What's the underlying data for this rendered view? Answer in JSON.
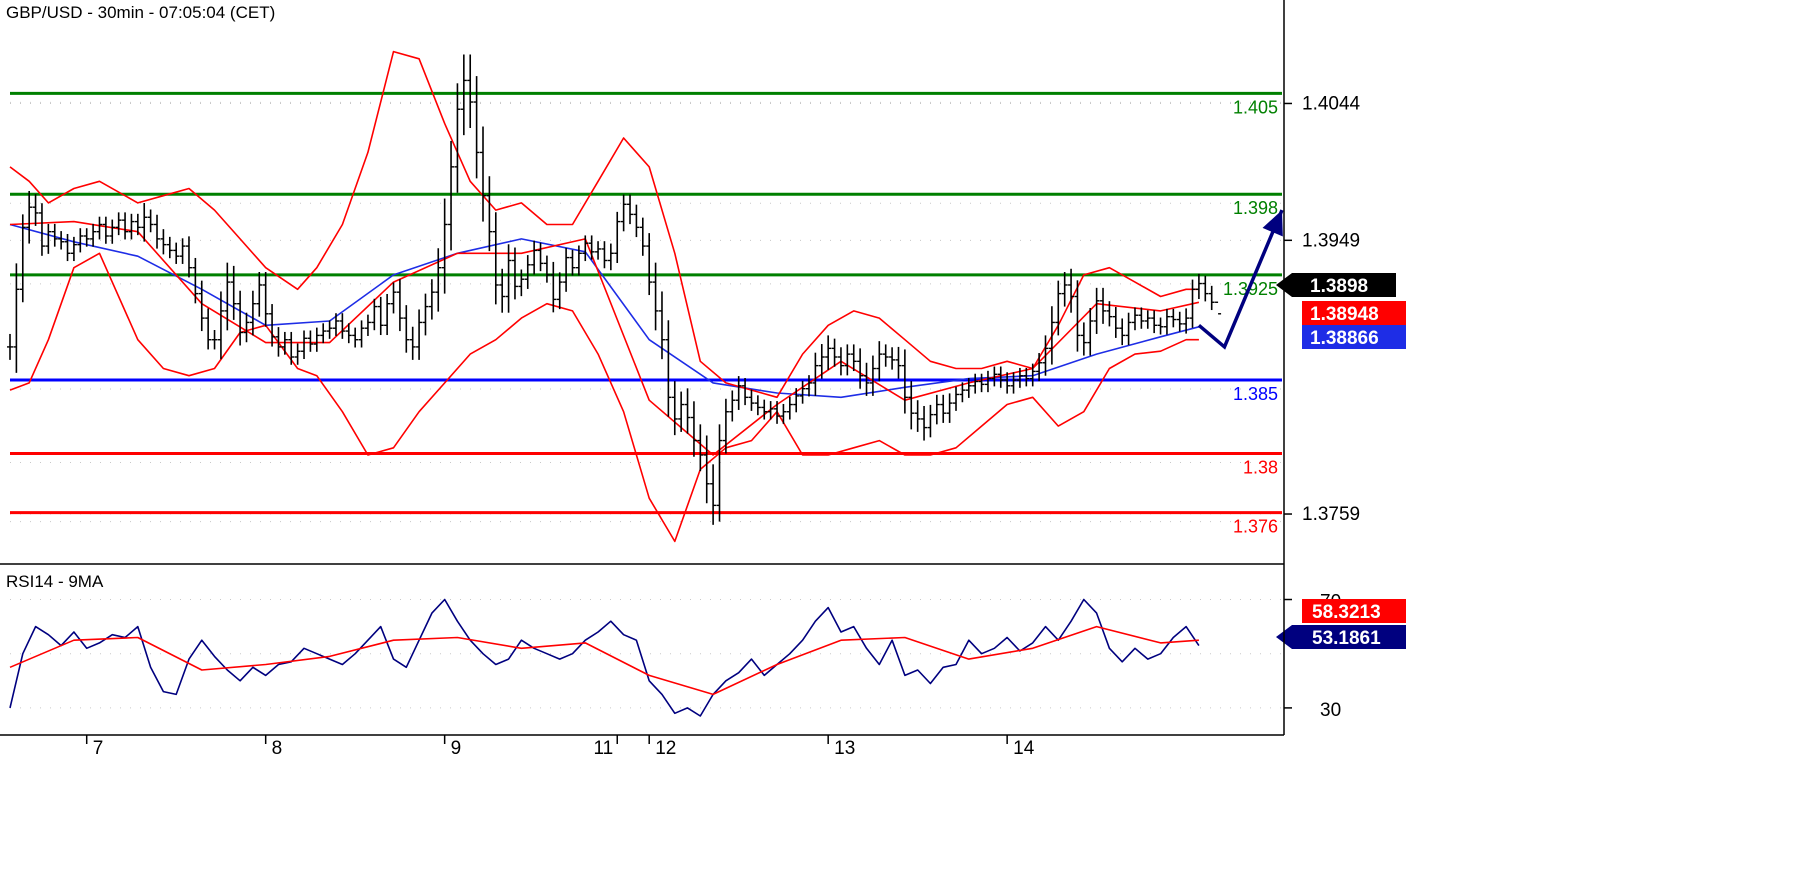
{
  "chart_data": [
    {
      "type": "line",
      "title": "GBP/USD - 30min - 07:05:04 (CET)",
      "ylim": [
        1.3725,
        1.4095
      ],
      "y_ticks": [
        "1.4044",
        "1.3949",
        "1.3759"
      ],
      "x_ticks": [
        "7",
        "8",
        "9",
        "11",
        "12",
        "13",
        "14"
      ],
      "grid": true,
      "levels": [
        {
          "label": "1.405",
          "value": 1.4051,
          "color": "#008000"
        },
        {
          "label": "1.398",
          "value": 1.3981,
          "color": "#008000"
        },
        {
          "label": "1.3925",
          "value": 1.3925,
          "color": "#008000"
        },
        {
          "label": "1.385",
          "value": 1.3852,
          "color": "#0000ff"
        },
        {
          "label": "1.38",
          "value": 1.3801,
          "color": "#ff0000"
        },
        {
          "label": "1.376",
          "value": 1.376,
          "color": "#ff0000"
        }
      ],
      "price_tags": [
        {
          "label": "1.3898",
          "value": 1.3898,
          "color": "#000000"
        },
        {
          "label": "1.38948",
          "value": 1.38948,
          "color": "#ff0000"
        },
        {
          "label": "1.38866",
          "value": 1.38866,
          "color": "#1e2de6"
        }
      ],
      "series": [
        {
          "type": "ohlc",
          "color": "#000000",
          "close": [
            1.3875,
            1.3915,
            1.3958,
            1.3972,
            1.3968,
            1.3945,
            1.3955,
            1.395,
            1.3948,
            1.394,
            1.3946,
            1.3952,
            1.395,
            1.3955,
            1.396,
            1.3952,
            1.3958,
            1.3963,
            1.3955,
            1.3962,
            1.3958,
            1.3965,
            1.396,
            1.395,
            1.3946,
            1.3942,
            1.3938,
            1.3945,
            1.393,
            1.3912,
            1.3895,
            1.388,
            1.388,
            1.39,
            1.392,
            1.3905,
            1.3885,
            1.3892,
            1.3905,
            1.3918,
            1.3898,
            1.3882,
            1.3875,
            1.388,
            1.3868,
            1.3872,
            1.3881,
            1.3877,
            1.3883,
            1.3886,
            1.3888,
            1.3893,
            1.3886,
            1.3883,
            1.388,
            1.3888,
            1.3892,
            1.3903,
            1.389,
            1.3905,
            1.3913,
            1.3895,
            1.388,
            1.3875,
            1.3892,
            1.3903,
            1.3913,
            1.393,
            1.396,
            1.4,
            1.404,
            1.406,
            1.4045,
            1.401,
            1.398,
            1.3955,
            1.3918,
            1.391,
            1.3935,
            1.3917,
            1.3922,
            1.3932,
            1.3942,
            1.3933,
            1.3925,
            1.3908,
            1.392,
            1.3937,
            1.393,
            1.394,
            1.3947,
            1.3941,
            1.3943,
            1.3935,
            1.394,
            1.3962,
            1.3974,
            1.3967,
            1.3958,
            1.3945,
            1.392,
            1.39,
            1.388,
            1.384,
            1.3825,
            1.3835,
            1.3826,
            1.381,
            1.38,
            1.378,
            1.3765,
            1.381,
            1.383,
            1.3838,
            1.3848,
            1.384,
            1.3836,
            1.3833,
            1.383,
            1.3832,
            1.3827,
            1.383,
            1.3835,
            1.3841,
            1.3846,
            1.385,
            1.3862,
            1.3868,
            1.3874,
            1.3868,
            1.3862,
            1.387,
            1.3865,
            1.3855,
            1.385,
            1.386,
            1.387,
            1.3868,
            1.3866,
            1.3862,
            1.384,
            1.3829,
            1.3825,
            1.3819,
            1.3828,
            1.3835,
            1.3829,
            1.3836,
            1.3842,
            1.3845,
            1.3848,
            1.3851,
            1.3849,
            1.3853,
            1.3856,
            1.3852,
            1.3848,
            1.3852,
            1.3855,
            1.3853,
            1.3858,
            1.3864,
            1.3874,
            1.3892,
            1.3912,
            1.3918,
            1.391,
            1.3883,
            1.3878,
            1.3893,
            1.3907,
            1.39,
            1.3896,
            1.3888,
            1.3883,
            1.3892,
            1.3897,
            1.3893,
            1.3895,
            1.389,
            1.3889,
            1.3896,
            1.3894,
            1.3891,
            1.3895,
            1.3915,
            1.3919,
            1.3912,
            1.3906,
            1.3898
          ],
          "range": [
            0.002,
            0.004,
            0.002,
            0.0025,
            0.002,
            0.0015,
            0.0012,
            0.0012,
            0.0012,
            0.0012,
            0.0012,
            0.0012,
            0.0012,
            0.0012,
            0.0012,
            0.0012,
            0.0012,
            0.0012,
            0.0012,
            0.0012,
            0.0012,
            0.0022,
            0.0012,
            0.0015,
            0.0015,
            0.0012,
            0.0012,
            0.0012,
            0.0015,
            0.0015,
            0.002,
            0.0015,
            0.0015,
            0.003,
            0.003,
            0.0025,
            0.002,
            0.0015,
            0.002,
            0.002,
            0.002,
            0.0015,
            0.0015,
            0.0012,
            0.0012,
            0.0012,
            0.0012,
            0.0012,
            0.0012,
            0.0012,
            0.0012,
            0.0012,
            0.0012,
            0.0012,
            0.0012,
            0.0012,
            0.0012,
            0.0012,
            0.0015,
            0.0015,
            0.0015,
            0.002,
            0.002,
            0.002,
            0.002,
            0.002,
            0.002,
            0.003,
            0.004,
            0.004,
            0.004,
            0.004,
            0.004,
            0.004,
            0.004,
            0.003,
            0.003,
            0.0025,
            0.0025,
            0.002,
            0.0015,
            0.0015,
            0.0015,
            0.0012,
            0.0012,
            0.002,
            0.0015,
            0.0015,
            0.0012,
            0.0012,
            0.0012,
            0.0012,
            0.0012,
            0.0012,
            0.0015,
            0.0015,
            0.0015,
            0.0015,
            0.0015,
            0.0015,
            0.002,
            0.003,
            0.003,
            0.003,
            0.0025,
            0.002,
            0.0025,
            0.0025,
            0.0025,
            0.003,
            0.003,
            0.0025,
            0.002,
            0.0015,
            0.0015,
            0.0012,
            0.0012,
            0.0012,
            0.0012,
            0.0012,
            0.0012,
            0.0012,
            0.0012,
            0.0012,
            0.0012,
            0.0012,
            0.002,
            0.002,
            0.002,
            0.0015,
            0.0015,
            0.0015,
            0.0015,
            0.002,
            0.002,
            0.002,
            0.002,
            0.0015,
            0.0015,
            0.002,
            0.0025,
            0.0025,
            0.002,
            0.002,
            0.0015,
            0.0015,
            0.0015,
            0.0015,
            0.0012,
            0.0012,
            0.0012,
            0.0012,
            0.0012,
            0.0012,
            0.0012,
            0.0012,
            0.0012,
            0.0012,
            0.0012,
            0.0012,
            0.0012,
            0.0015,
            0.002,
            0.0025,
            0.002,
            0.002,
            0.0025,
            0.0025,
            0.002,
            0.002,
            0.002,
            0.002,
            0.0015,
            0.0015,
            0.0015,
            0.0015,
            0.0012,
            0.0012,
            0.0012,
            0.0012,
            0.0012,
            0.0012,
            0.0012,
            0.0012,
            0.0015,
            0.0015,
            0.0015,
            0.0012,
            0.0012
          ]
        },
        {
          "name": "",
          "type": "line",
          "color": "#1e2de6",
          "x": [
            0,
            10,
            20,
            30,
            40,
            50,
            60,
            70,
            80,
            90,
            100,
            110,
            120,
            130,
            140,
            150,
            160,
            170,
            180,
            186
          ],
          "y": [
            1.396,
            1.3948,
            1.3938,
            1.3915,
            1.389,
            1.3893,
            1.3925,
            1.394,
            1.395,
            1.3941,
            1.388,
            1.385,
            1.3843,
            1.384,
            1.3847,
            1.3853,
            1.3855,
            1.387,
            1.3882,
            1.3889
          ]
        },
        {
          "name": "",
          "type": "line",
          "color": "#ff0000",
          "x": [
            0,
            10,
            20,
            30,
            40,
            50,
            60,
            70,
            80,
            90,
            100,
            110,
            120,
            130,
            140,
            150,
            160,
            170,
            180,
            186
          ],
          "y": [
            1.396,
            1.3962,
            1.3955,
            1.3905,
            1.3878,
            1.3878,
            1.392,
            1.394,
            1.394,
            1.395,
            1.3838,
            1.38,
            1.3835,
            1.3865,
            1.3838,
            1.385,
            1.386,
            1.3905,
            1.39,
            1.3906
          ]
        },
        {
          "name": "",
          "type": "line",
          "color": "#ff0000",
          "x": [
            0,
            3,
            6,
            10,
            14,
            20,
            24,
            28,
            32,
            36,
            40,
            45,
            48,
            52,
            56,
            60,
            64,
            68,
            72,
            76,
            80,
            84,
            88,
            92,
            96,
            100,
            104,
            108,
            112,
            116,
            120,
            124,
            128,
            132,
            136,
            140,
            144,
            148,
            152,
            156,
            160,
            164,
            168,
            172,
            176,
            180,
            184,
            186
          ],
          "y": [
            1.4,
            1.399,
            1.3975,
            1.3985,
            1.399,
            1.3975,
            1.398,
            1.3985,
            1.397,
            1.395,
            1.393,
            1.3915,
            1.393,
            1.396,
            1.401,
            1.408,
            1.4075,
            1.403,
            1.399,
            1.397,
            1.3975,
            1.396,
            1.396,
            1.399,
            1.402,
            1.4,
            1.394,
            1.3865,
            1.385,
            1.3845,
            1.384,
            1.387,
            1.389,
            1.39,
            1.3895,
            1.388,
            1.3865,
            1.386,
            1.386,
            1.3865,
            1.386,
            1.389,
            1.3925,
            1.393,
            1.392,
            1.391,
            1.3915,
            1.3915
          ]
        },
        {
          "name": "",
          "type": "line",
          "color": "#ff0000",
          "x": [
            0,
            3,
            6,
            10,
            14,
            20,
            24,
            28,
            32,
            36,
            40,
            45,
            48,
            52,
            56,
            60,
            64,
            68,
            72,
            76,
            80,
            84,
            88,
            92,
            96,
            100,
            104,
            108,
            112,
            116,
            120,
            124,
            128,
            132,
            136,
            140,
            144,
            148,
            152,
            156,
            160,
            164,
            168,
            172,
            176,
            180,
            184,
            186
          ],
          "y": [
            1.3845,
            1.385,
            1.388,
            1.393,
            1.394,
            1.388,
            1.386,
            1.3855,
            1.386,
            1.3885,
            1.389,
            1.386,
            1.3855,
            1.383,
            1.38,
            1.3805,
            1.383,
            1.385,
            1.387,
            1.388,
            1.3895,
            1.3905,
            1.39,
            1.387,
            1.383,
            1.377,
            1.374,
            1.379,
            1.3805,
            1.381,
            1.383,
            1.38,
            1.38,
            1.3805,
            1.381,
            1.38,
            1.38,
            1.3805,
            1.382,
            1.3835,
            1.384,
            1.382,
            1.383,
            1.386,
            1.387,
            1.3872,
            1.388,
            1.388
          ]
        }
      ],
      "arrow": {
        "from": [
          186,
          1.389
        ],
        "via": [
          190,
          1.3875
        ],
        "to": [
          199,
          1.397
        ],
        "color": "#00007f"
      }
    },
    {
      "type": "line",
      "title": "RSI14 - 9MA",
      "ylim": [
        20,
        82
      ],
      "y_ticks": [
        "70",
        "30"
      ],
      "grid": true,
      "value_tags": [
        {
          "label": "58.3213",
          "value": 58.3213,
          "color": "#ff0000"
        },
        {
          "label": "53.1861",
          "value": 53.1861,
          "color": "#00007f"
        }
      ],
      "series": [
        {
          "name": "",
          "type": "line",
          "color": "#00007f",
          "x": [
            0,
            2,
            4,
            6,
            8,
            10,
            12,
            14,
            16,
            18,
            20,
            22,
            24,
            26,
            28,
            30,
            32,
            34,
            36,
            38,
            40,
            42,
            44,
            46,
            48,
            50,
            52,
            54,
            56,
            58,
            60,
            62,
            64,
            66,
            68,
            70,
            72,
            74,
            76,
            78,
            80,
            82,
            84,
            86,
            88,
            90,
            92,
            94,
            96,
            98,
            100,
            102,
            104,
            106,
            108,
            110,
            112,
            114,
            116,
            118,
            120,
            122,
            124,
            126,
            128,
            130,
            132,
            134,
            136,
            138,
            140,
            142,
            144,
            146,
            148,
            150,
            152,
            154,
            156,
            158,
            160,
            162,
            164,
            166,
            168,
            170,
            172,
            174,
            176,
            178,
            180,
            182,
            184,
            186
          ],
          "y": [
            30,
            50,
            60,
            57,
            53,
            58,
            52,
            54,
            57,
            56,
            60,
            45,
            36,
            35,
            48,
            55,
            49,
            44,
            40,
            45,
            42,
            46,
            47,
            52,
            50,
            48,
            46,
            50,
            55,
            60,
            48,
            45,
            55,
            65,
            70,
            62,
            55,
            50,
            46,
            48,
            55,
            52,
            50,
            48,
            50,
            55,
            58,
            62,
            57,
            55,
            40,
            35,
            28,
            30,
            27,
            35,
            40,
            43,
            48,
            42,
            46,
            50,
            55,
            62,
            67,
            58,
            60,
            52,
            46,
            55,
            42,
            44,
            39,
            45,
            46,
            55,
            50,
            52,
            56,
            51,
            54,
            60,
            55,
            62,
            70,
            65,
            52,
            47,
            52,
            48,
            50,
            56,
            60,
            53
          ]
        },
        {
          "name": "",
          "type": "line",
          "color": "#ff0000",
          "x": [
            0,
            10,
            20,
            30,
            40,
            50,
            60,
            70,
            80,
            90,
            100,
            110,
            120,
            130,
            140,
            150,
            160,
            170,
            180,
            186
          ],
          "y": [
            45,
            55,
            56,
            44,
            46,
            49,
            55,
            56,
            52,
            54,
            42,
            35,
            46,
            55,
            56,
            48,
            52,
            60,
            54,
            55
          ]
        }
      ]
    }
  ]
}
